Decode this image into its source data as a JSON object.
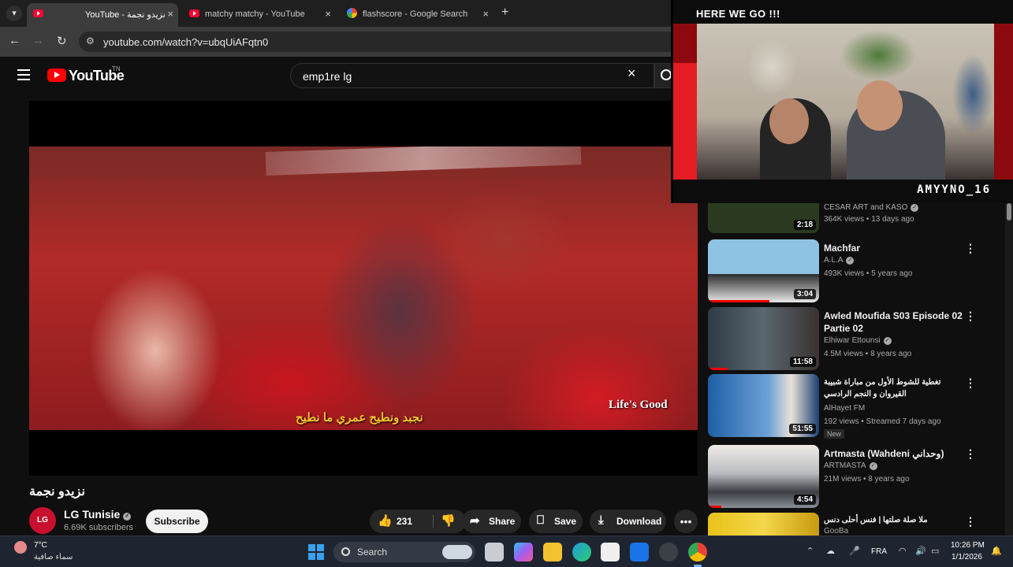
{
  "browser": {
    "tabs": [
      {
        "title": "YouTube - نزيدو نجمة",
        "active": true,
        "favicon": "youtube-icon"
      },
      {
        "title": "matchy matchy - YouTube",
        "active": false,
        "favicon": "youtube-icon"
      },
      {
        "title": "flashscore - Google Search",
        "active": false,
        "favicon": "google-icon"
      }
    ],
    "url": "youtube.com/watch?v=ubqUiAFqtn0",
    "close_glyph": "×",
    "new_tab_glyph": "+"
  },
  "youtube": {
    "logo_text": "YouTube",
    "country_code": "TN",
    "search_query": "emp1re lg"
  },
  "video": {
    "subtitle": "نجبد ونطيح عمري ما نطيح",
    "watermark": "Life's Good",
    "title": "نزيدو نجمة",
    "channel": {
      "avatar_text": "LG",
      "name": "LG Tunisie",
      "subscribers": "6.69K subscribers"
    },
    "subscribe_label": "Subscribe",
    "likes": "231",
    "share_label": "Share",
    "save_label": "Save",
    "download_label": "Download"
  },
  "stream_overlay": {
    "header": "HERE WE GO !!!",
    "username": "AMYYNO_16"
  },
  "recommendations": [
    {
      "title": "",
      "channel": "CESAR ART and KASO",
      "meta": "364K views • 13 days ago",
      "duration": "2:18",
      "thumb_color": "#2a3a20",
      "progress": 0
    },
    {
      "title": "Machfar",
      "channel": "A.L.A",
      "meta": "493K views • 5 years ago",
      "duration": "3:04",
      "thumb_color": "#7fb6d8",
      "progress": 0.55
    },
    {
      "title": "Awled Moufida S03 Episode 02 Partie 02",
      "channel": "Elhiwar Ettounsi",
      "meta": "4.5M views • 8 years ago",
      "duration": "11:58",
      "thumb_color": "#3a4a55",
      "progress": 0.18
    },
    {
      "title": "تغطية للشوط الأول من مباراة شبيبة القيروان و النجم الرادسي",
      "channel": "AlHayet FM",
      "meta": "192 views • Streamed 7 days ago",
      "badge": "New",
      "duration": "51:55",
      "thumb_color": "#1e4e8a",
      "progress": 0
    },
    {
      "title": "Artmasta (Wahdeni وحداني)",
      "channel": "ARTMASTA",
      "meta": "21M views • 8 years ago",
      "duration": "4:54",
      "thumb_color": "#8a8f96",
      "progress": 0.12
    },
    {
      "title": "ملا صلة صلتها | فنس أحلى دنس",
      "channel": "GooBa",
      "meta": "",
      "duration": "",
      "thumb_color": "#d4b018",
      "progress": 0
    }
  ],
  "taskbar": {
    "weather_temp": "7°C",
    "weather_desc": "سماء صافية",
    "search_label": "Search",
    "language": "FRA",
    "time": "10:26 PM",
    "date": "1/1/2026"
  }
}
